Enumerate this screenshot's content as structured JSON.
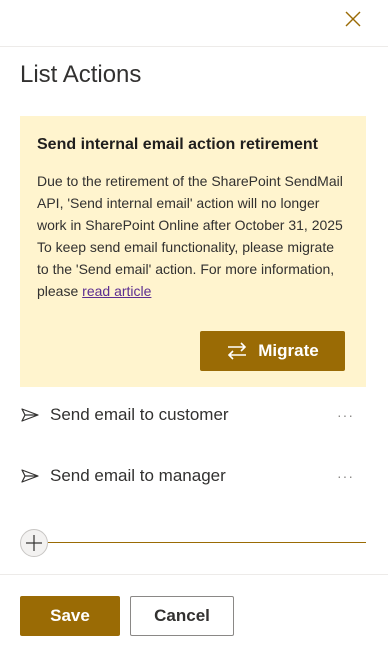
{
  "panel": {
    "close_icon": "close-icon",
    "title": "List Actions"
  },
  "banner": {
    "title": "Send internal email action retirement",
    "body_prefix": "Due to the retirement of the SharePoint SendMail API, 'Send internal email' action will no longer work in SharePoint Online after October 31, 2025 To keep send email functionality, please migrate to the 'Send email' action. For more information, please ",
    "link_text": "read article",
    "migrate_label": "Migrate",
    "background": "#fff4ce"
  },
  "actions": [
    {
      "label": "Send email to customer",
      "icon": "send-icon",
      "more": "···"
    },
    {
      "label": "Send email to manager",
      "icon": "send-icon",
      "more": "···"
    }
  ],
  "add": {
    "icon": "plus-icon"
  },
  "footer": {
    "save_label": "Save",
    "cancel_label": "Cancel"
  },
  "colors": {
    "accent": "#9a6b05",
    "link": "#5c2d91"
  }
}
